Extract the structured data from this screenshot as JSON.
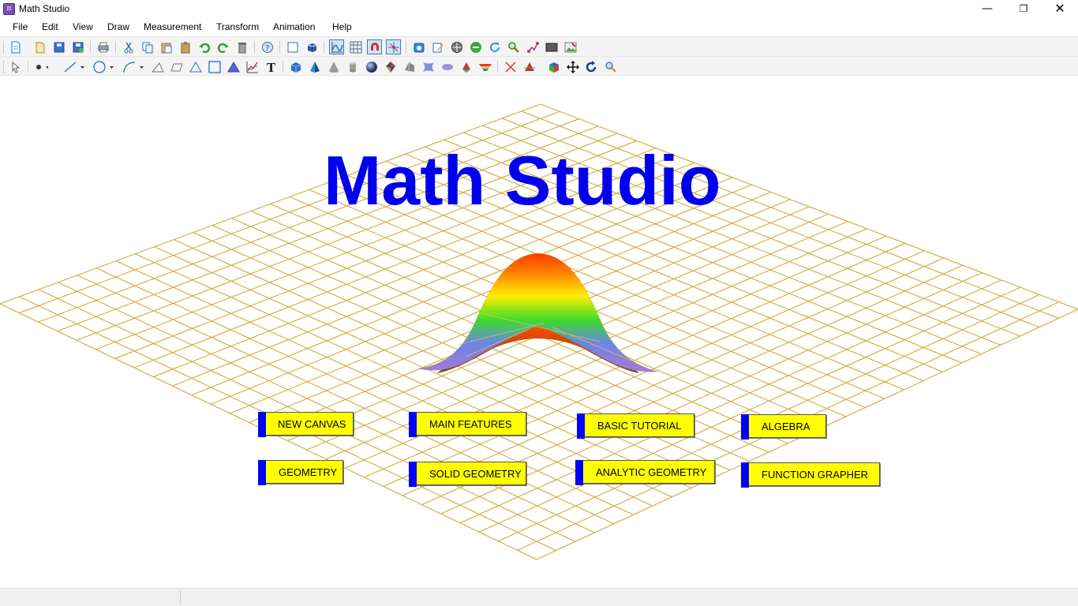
{
  "window": {
    "title": "Math Studio",
    "icon": "pi-app-icon",
    "controls": {
      "minimize": "—",
      "maximize": "❐",
      "close": "✕"
    }
  },
  "menu": [
    "File",
    "Edit",
    "View",
    "Draw",
    "Measurement",
    "Transform",
    "Animation",
    "Help"
  ],
  "toolbar1": {
    "icons": [
      "new-file-icon",
      "open-file-icon",
      "save-icon",
      "save-as-icon",
      "print-icon",
      "cut-icon",
      "copy-icon",
      "paste-icon",
      "clipboard-icon",
      "undo-icon",
      "redo-icon",
      "delete-icon",
      "help-icon",
      "canvas-2d-icon",
      "canvas-3d-icon",
      "graph-icon",
      "grid-icon",
      "magnet-icon",
      "axes-icon",
      "camera-icon",
      "edit-icon",
      "center-icon",
      "remove-icon",
      "refresh-icon",
      "zoom-icon",
      "path-icon",
      "screen-icon",
      "image-icon"
    ],
    "active": [
      "graph-icon",
      "magnet-icon",
      "axes-icon"
    ]
  },
  "toolbar2": {
    "icons": [
      "select-arrow-icon",
      "point-icon",
      "line-icon",
      "circle-icon",
      "arc-icon",
      "triangle-outline-icon",
      "parallelogram-icon",
      "triangle-icon",
      "rectangle-icon",
      "filled-triangle-icon",
      "function-plot-icon",
      "text-icon",
      "cube-icon",
      "pyramid-icon",
      "cone-icon",
      "cylinder-icon",
      "sphere-icon",
      "polyhedron-icon",
      "prism-icon",
      "hyperboloid-icon",
      "ellipsoid-icon",
      "cone-section-icon",
      "surface-icon",
      "intersection-icon",
      "solid-cut-icon",
      "color-solid-icon",
      "move-icon",
      "rotate-icon",
      "zoom-icon"
    ]
  },
  "main": {
    "title": "Math Studio",
    "buttons": [
      {
        "id": "new-canvas",
        "label": "NEW CANVAS"
      },
      {
        "id": "main-features",
        "label": "MAIN FEATURES"
      },
      {
        "id": "basic-tutorial",
        "label": "BASIC TUTORIAL"
      },
      {
        "id": "algebra",
        "label": "ALGEBRA"
      },
      {
        "id": "geometry",
        "label": "GEOMETRY"
      },
      {
        "id": "solid-geometry",
        "label": "SOLID GEOMETRY"
      },
      {
        "id": "analytic-geometry",
        "label": "ANALYTIC GEOMETRY"
      },
      {
        "id": "function-grapher",
        "label": "FUNCTION GRAPHER"
      }
    ]
  },
  "colors": {
    "title": "#0000ee",
    "button_fill": "#ffff00",
    "button_tab": "#0000ff",
    "grid_line": "#d4a93a"
  }
}
